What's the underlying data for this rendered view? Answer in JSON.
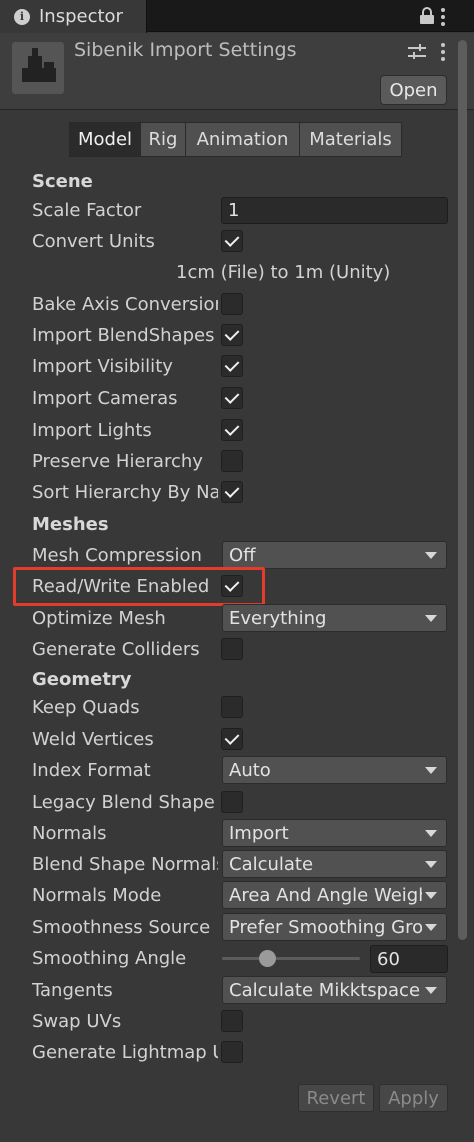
{
  "window": {
    "tab_title": "Inspector",
    "tab_icon": "info-icon",
    "lock_icon": "lock-icon",
    "menu_icon": "kebab-menu-icon"
  },
  "header": {
    "title": "Sibenik Import Settings",
    "open_label": "Open",
    "presets_icon": "presets-sliders-icon"
  },
  "tabs": [
    "Model",
    "Rig",
    "Animation",
    "Materials"
  ],
  "active_tab": "Model",
  "scene": {
    "heading": "Scene",
    "scale_factor_label": "Scale Factor",
    "scale_factor_value": "1",
    "convert_units_label": "Convert Units",
    "convert_units_checked": true,
    "unit_note": "1cm (File) to 1m (Unity)",
    "bake_axis_label": "Bake Axis Conversion",
    "bake_axis_checked": false,
    "import_blendshapes_label": "Import BlendShapes",
    "import_blendshapes_checked": true,
    "import_visibility_label": "Import Visibility",
    "import_visibility_checked": true,
    "import_cameras_label": "Import Cameras",
    "import_cameras_checked": true,
    "import_lights_label": "Import Lights",
    "import_lights_checked": true,
    "preserve_hierarchy_label": "Preserve Hierarchy",
    "preserve_hierarchy_checked": false,
    "sort_hierarchy_label": "Sort Hierarchy By Name",
    "sort_hierarchy_checked": true
  },
  "meshes": {
    "heading": "Meshes",
    "mesh_compression_label": "Mesh Compression",
    "mesh_compression_value": "Off",
    "read_write_label": "Read/Write Enabled",
    "read_write_checked": true,
    "optimize_mesh_label": "Optimize Mesh",
    "optimize_mesh_value": "Everything",
    "generate_colliders_label": "Generate Colliders",
    "generate_colliders_checked": false
  },
  "geometry": {
    "heading": "Geometry",
    "keep_quads_label": "Keep Quads",
    "keep_quads_checked": false,
    "weld_vertices_label": "Weld Vertices",
    "weld_vertices_checked": true,
    "index_format_label": "Index Format",
    "index_format_value": "Auto",
    "legacy_blend_label": "Legacy Blend Shape Normals",
    "legacy_blend_checked": false,
    "normals_label": "Normals",
    "normals_value": "Import",
    "blend_normals_label": "Blend Shape Normals",
    "blend_normals_value": "Calculate",
    "normals_mode_label": "Normals Mode",
    "normals_mode_value": "Area And Angle Weighted",
    "smoothness_source_label": "Smoothness Source",
    "smoothness_source_value": "Prefer Smoothing Groups",
    "smoothing_angle_label": "Smoothing Angle",
    "smoothing_angle_value": "60",
    "smoothing_angle_fraction": 0.333,
    "tangents_label": "Tangents",
    "tangents_value": "Calculate Mikktspace",
    "swap_uvs_label": "Swap UVs",
    "swap_uvs_checked": false,
    "lightmap_uvs_label": "Generate Lightmap UVs",
    "lightmap_uvs_checked": false
  },
  "footer": {
    "revert_label": "Revert",
    "apply_label": "Apply"
  },
  "colors": {
    "background": "#383838",
    "highlight_box": "#e33b2c",
    "active_tab": "#2b2b2b"
  }
}
